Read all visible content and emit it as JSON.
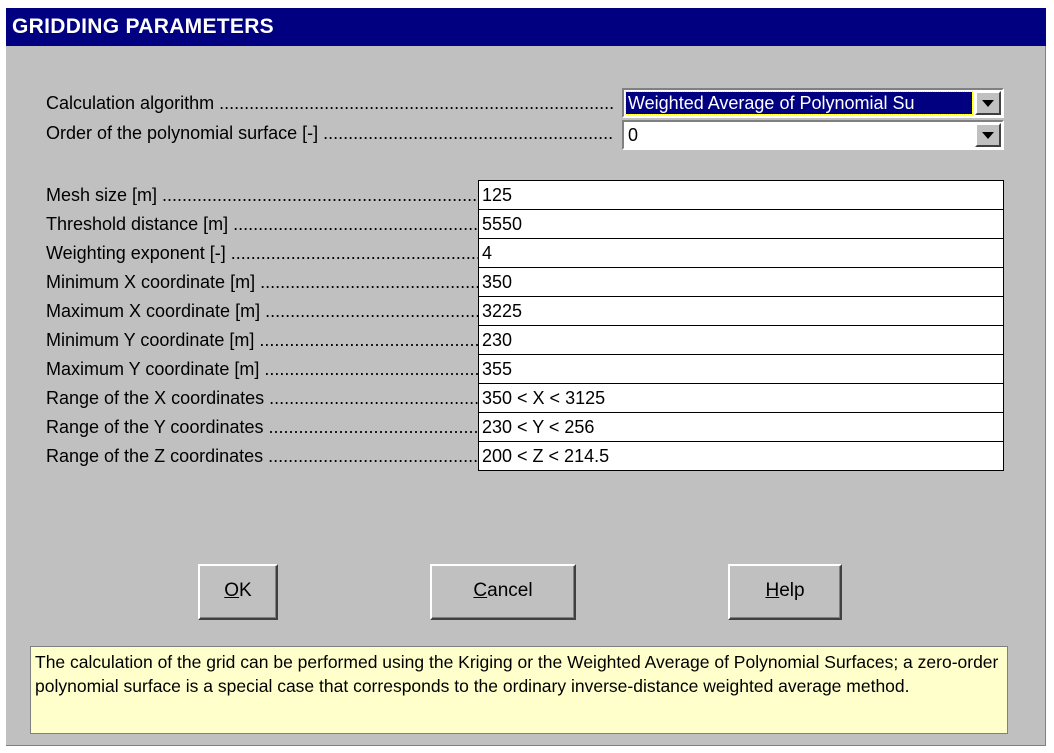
{
  "window": {
    "title": "GRIDDING PARAMETERS"
  },
  "algorithm": {
    "label": "Calculation algorithm ...............................................................................",
    "value": "Weighted Average of Polynomial Su"
  },
  "order": {
    "label": "Order of the polynomial surface [-] ..........................................................",
    "value": "0"
  },
  "fields": [
    {
      "label": "Mesh size [m] ......................................................................",
      "value": "125"
    },
    {
      "label": "Threshold distance [m] ......................................................",
      "value": "5550"
    },
    {
      "label": "Weighting exponent  [-] .....................................................",
      "value": "4"
    },
    {
      "label": "Minimum X coordinate [m] ...................................................",
      "value": "350"
    },
    {
      "label": "Maximum X coordinate [m] ...................................................",
      "value": "3225"
    },
    {
      "label": "Minimum Y coordinate [m] ...................................................",
      "value": "230"
    },
    {
      "label": "Maximum Y coordinate [m] ...................................................",
      "value": "355"
    },
    {
      "label": "Range of the X coordinates ....................................................",
      "value": "350 < X < 3125"
    },
    {
      "label": "Range of the Y coordinates ....................................................",
      "value": "230 < Y < 256"
    },
    {
      "label": "Range of the Z coordinates ....................................................",
      "value": "200 < Z < 214.5"
    }
  ],
  "buttons": {
    "ok": {
      "mnemonic": "O",
      "rest": "K"
    },
    "cancel": {
      "mnemonic": "C",
      "rest": "ancel"
    },
    "help": {
      "mnemonic": "H",
      "rest": "elp"
    }
  },
  "help_text": "The calculation of the grid can be performed using the Kriging or the Weighted Average of Polynomial Surfaces; a zero-order polynomial surface is a special case that corresponds to the ordinary inverse-distance weighted average method."
}
